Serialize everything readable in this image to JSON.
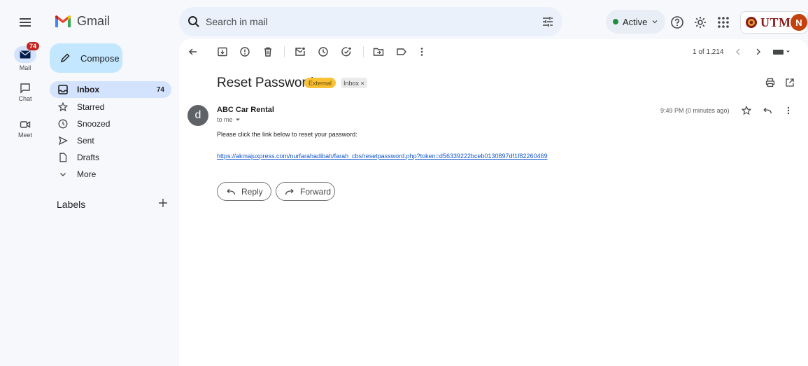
{
  "app": {
    "logo_text": "Gmail",
    "colors": {
      "accent": "#0b57d0",
      "compose_bg": "#c2e7ff",
      "selected_nav": "#d3e3fd",
      "external_chip": "#f9c235"
    }
  },
  "search": {
    "placeholder": "Search in mail"
  },
  "status": {
    "label": "Active"
  },
  "org_badge": {
    "text": "UTM"
  },
  "account": {
    "avatar_letter": "N"
  },
  "rail": {
    "mail": {
      "label": "Mail",
      "badge": "74"
    },
    "chat": {
      "label": "Chat"
    },
    "meet": {
      "label": "Meet"
    }
  },
  "compose": {
    "label": "Compose"
  },
  "nav": {
    "inbox": {
      "label": "Inbox",
      "count": "74"
    },
    "starred": {
      "label": "Starred"
    },
    "snoozed": {
      "label": "Snoozed"
    },
    "sent": {
      "label": "Sent"
    },
    "drafts": {
      "label": "Drafts"
    },
    "more": {
      "label": "More"
    }
  },
  "labels": {
    "title": "Labels"
  },
  "pager": {
    "text": "1 of 1,214"
  },
  "message": {
    "subject": "Reset Password",
    "chips": {
      "external": "External",
      "inbox": "Inbox ×"
    },
    "sender": {
      "avatar_letter": "d",
      "name": "ABC Car Rental",
      "to": "to me"
    },
    "timestamp": "9:49 PM (0 minutes ago)",
    "body": "Please click the link below to reset your password:",
    "link": "https://akmajuxpress.com/nurfarahadibah/farah_cbs/resetpassword.php?token=d56339222bceb0130897df1f82260469"
  },
  "actions": {
    "reply": "Reply",
    "forward": "Forward"
  }
}
